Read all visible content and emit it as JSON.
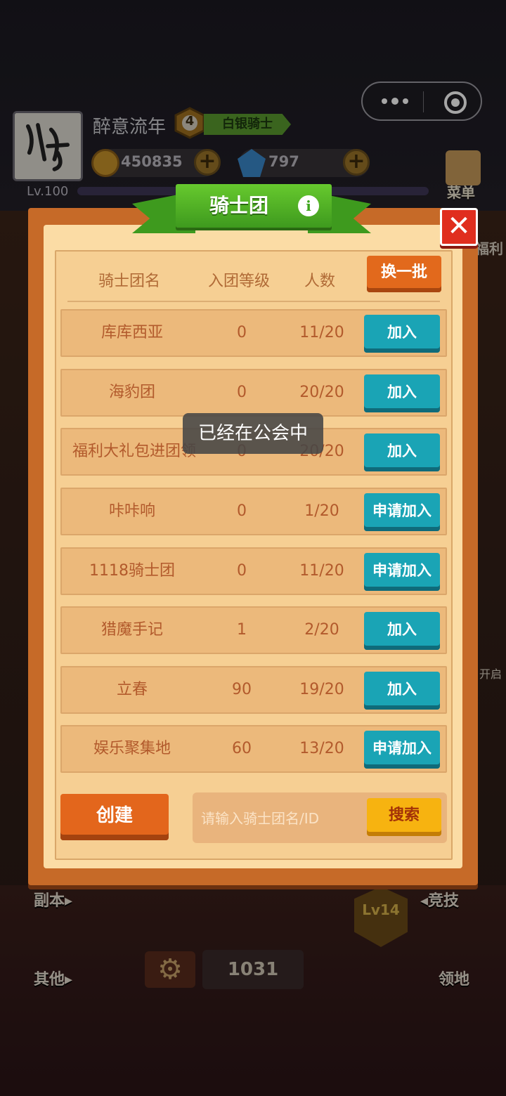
{
  "header": {
    "username": "醉意流年",
    "rank_level": "4",
    "rank_title": "白银骑士",
    "player_level": "Lv.100",
    "gold": "450835",
    "gems": "797",
    "menu_label": "菜单",
    "side_right_label": "福利",
    "side_right_label2": "开启"
  },
  "bottom": {
    "dungeon_label": "副本▸",
    "arena_label": "◂竞技",
    "other_label": "其他▸",
    "territory_label": "领地",
    "power_value": "1031",
    "level_badge": "Lv14"
  },
  "modal": {
    "title": "骑士团",
    "refresh_label": "换一批",
    "columns": {
      "name": "骑士团名",
      "level": "入团等级",
      "count": "人数"
    },
    "rows": [
      {
        "name": "库库西亚",
        "level": "0",
        "count": "11/20",
        "action": "加入"
      },
      {
        "name": "海豹团",
        "level": "0",
        "count": "20/20",
        "action": "加入"
      },
      {
        "name": "福利大礼包进团领",
        "level": "0",
        "count": "20/20",
        "action": "加入"
      },
      {
        "name": "咔咔响",
        "level": "0",
        "count": "1/20",
        "action": "申请加入"
      },
      {
        "name": "1118骑士团",
        "level": "0",
        "count": "11/20",
        "action": "申请加入"
      },
      {
        "name": "猎魔手记",
        "level": "1",
        "count": "2/20",
        "action": "加入"
      },
      {
        "name": "立春",
        "level": "90",
        "count": "19/20",
        "action": "加入"
      },
      {
        "name": "娱乐聚集地",
        "level": "60",
        "count": "13/20",
        "action": "申请加入"
      }
    ],
    "create_label": "创建",
    "search_placeholder": "请输入骑士团名/ID",
    "search_label": "搜索",
    "close_symbol": "✕"
  },
  "toast": {
    "text": "已经在公会中"
  },
  "colors": {
    "join": "#1aa4b5",
    "orange": "#e3661c",
    "yellow": "#f7b310",
    "ribbon": "#3e9a1e"
  }
}
